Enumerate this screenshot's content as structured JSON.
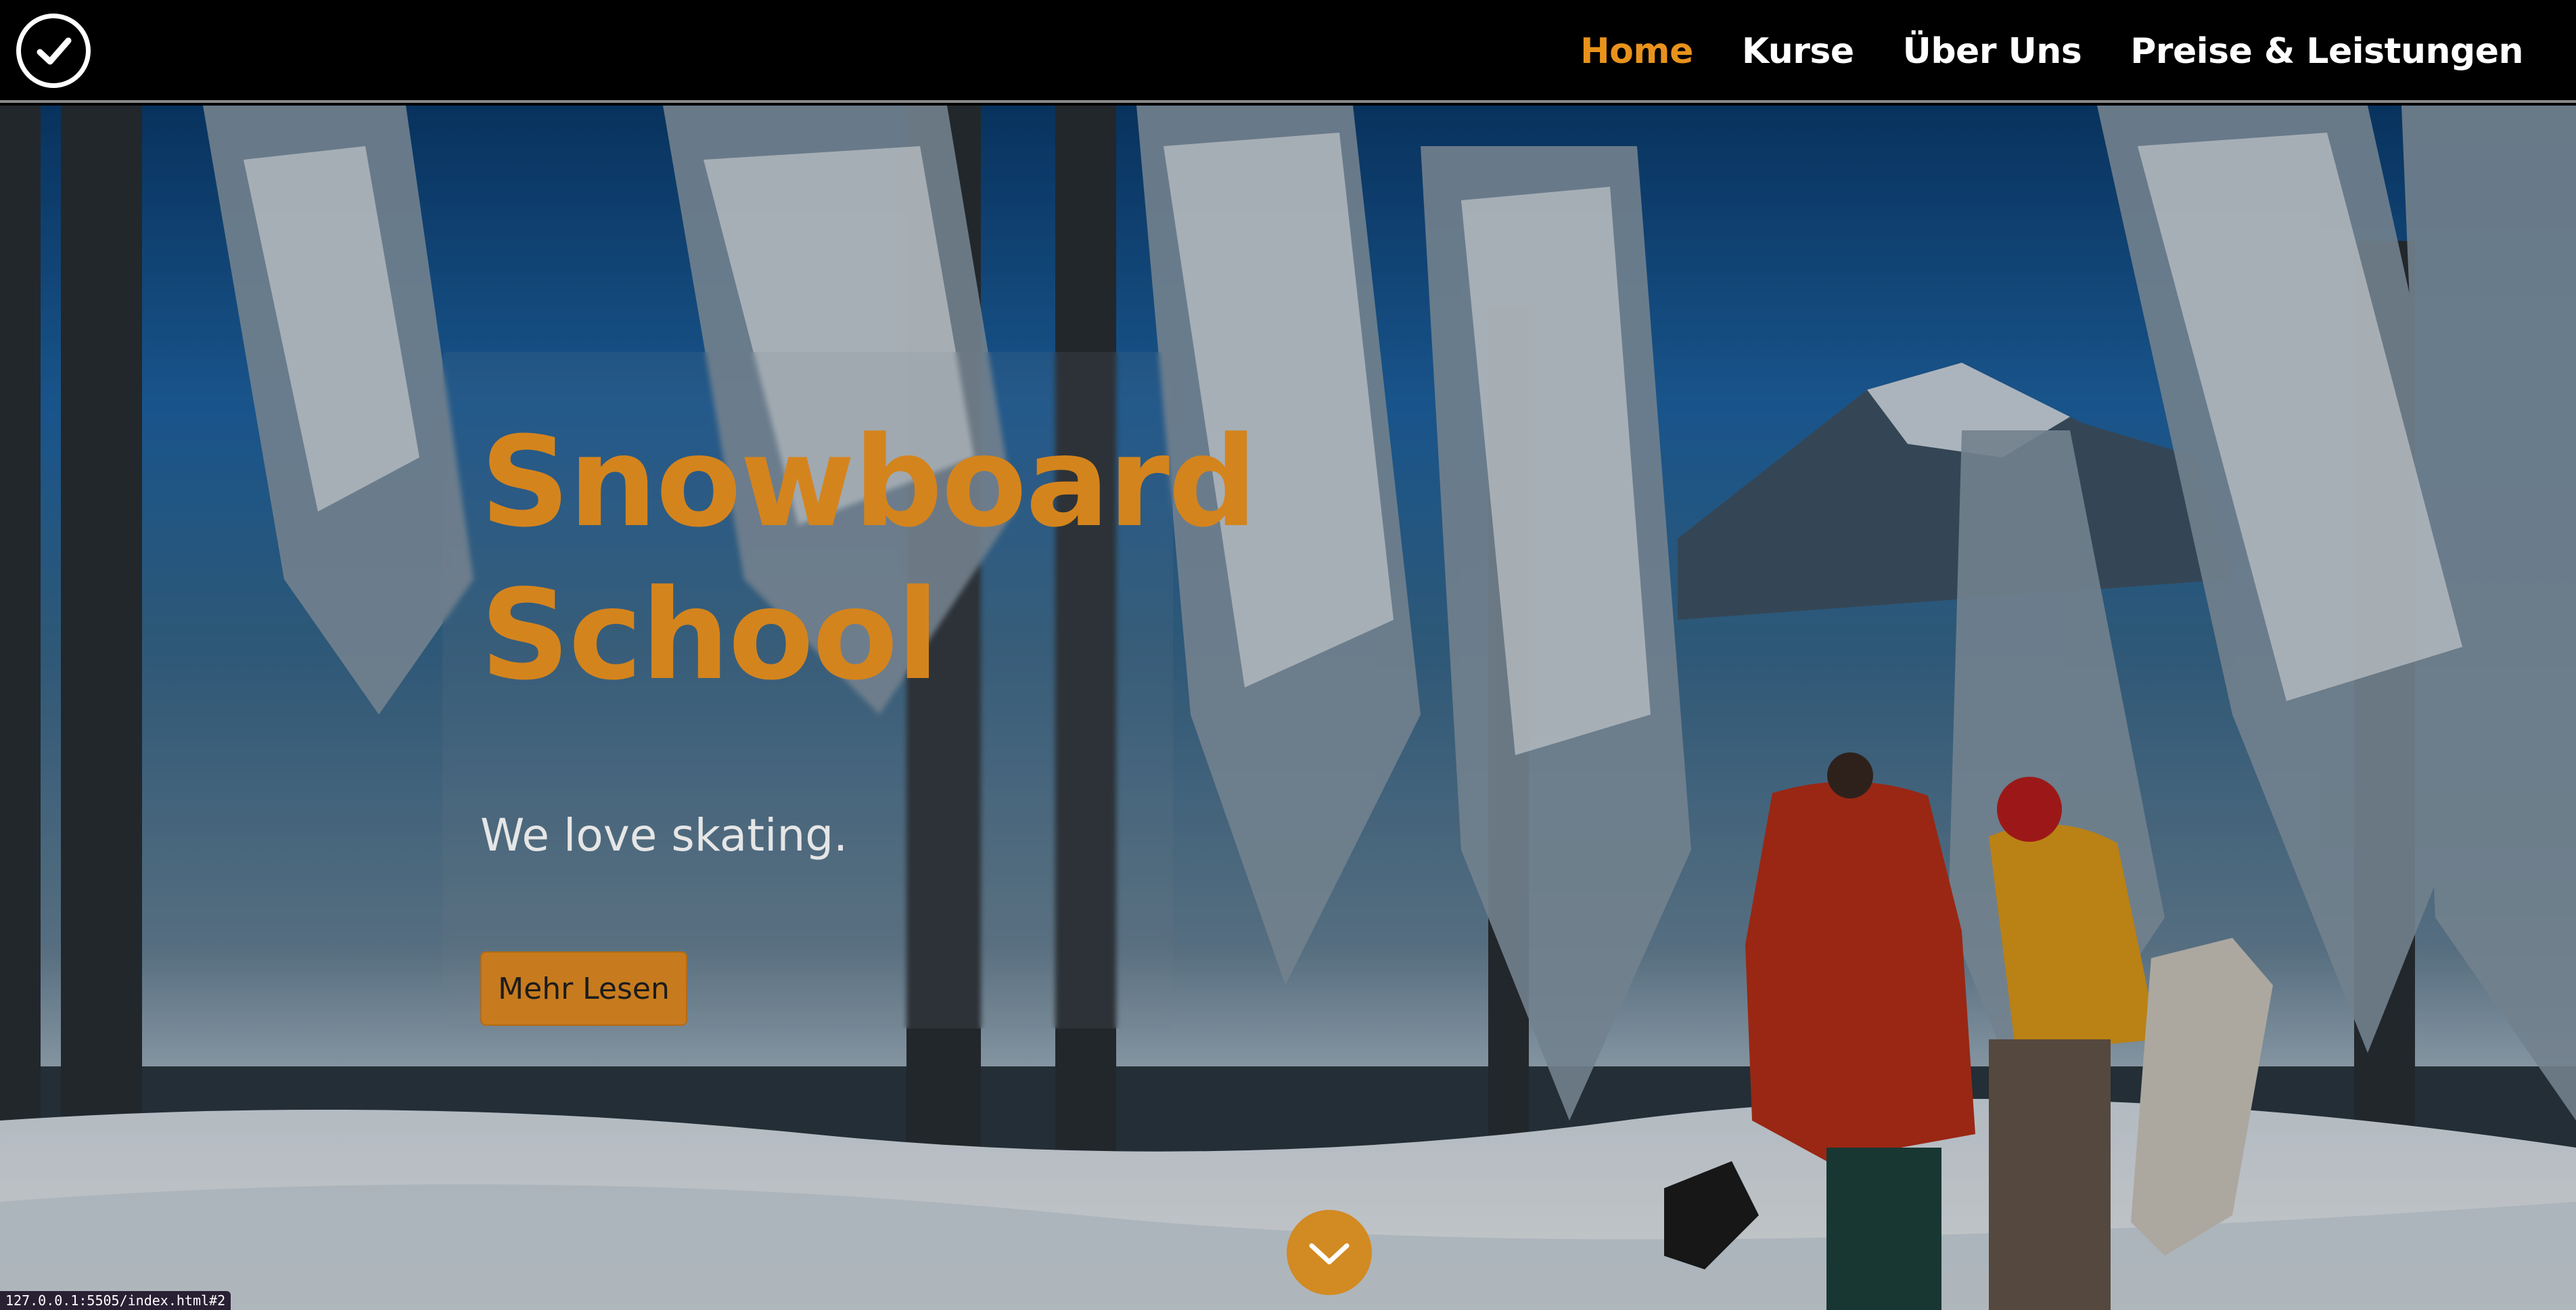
{
  "brand": {
    "logo_icon": "check-circle-icon"
  },
  "nav": {
    "items": [
      {
        "label": "Home",
        "active": true
      },
      {
        "label": "Kurse",
        "active": false
      },
      {
        "label": "Über Uns",
        "active": false
      },
      {
        "label": "Preise & Leistungen",
        "active": false
      }
    ]
  },
  "hero": {
    "title_line1": "Snowboard",
    "title_line2": "School",
    "subtitle": "We love skating.",
    "cta_label": "Mehr Lesen",
    "scroll_icon": "chevron-down-icon"
  },
  "status_bar": {
    "url": "127.0.0.1:5505/index.html#2"
  },
  "colors": {
    "accent": "#e8921c",
    "button": "#c77b1e",
    "nav_bg": "#000000"
  }
}
